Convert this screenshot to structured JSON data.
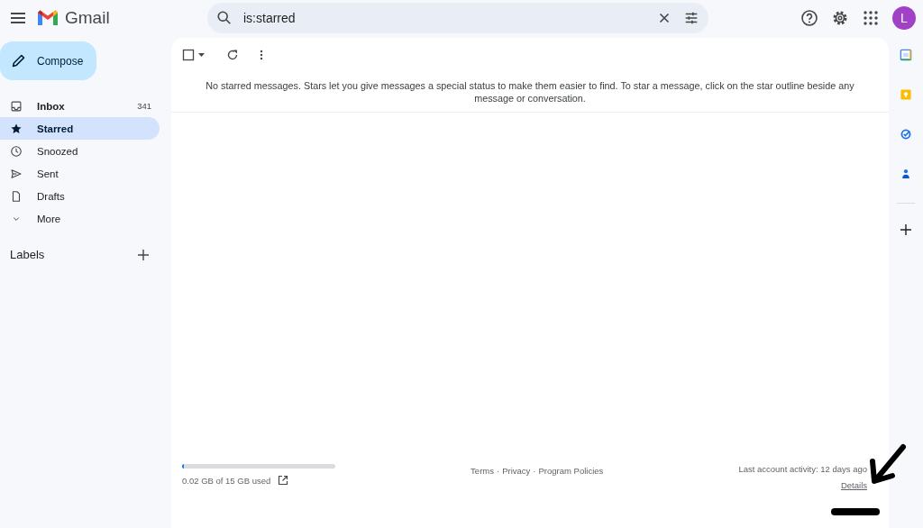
{
  "app": {
    "name": "Gmail"
  },
  "search": {
    "value": "is:starred"
  },
  "account": {
    "initial": "L",
    "color": "#a142c6"
  },
  "compose": {
    "label": "Compose"
  },
  "nav": [
    {
      "kind": "inbox",
      "label": "Inbox",
      "count": "341",
      "selected": false,
      "bold": true
    },
    {
      "kind": "star",
      "label": "Starred",
      "selected": true,
      "bold": true
    },
    {
      "kind": "clock",
      "label": "Snoozed",
      "selected": false,
      "bold": false
    },
    {
      "kind": "send",
      "label": "Sent",
      "selected": false,
      "bold": false
    },
    {
      "kind": "file",
      "label": "Drafts",
      "selected": false,
      "bold": false
    },
    {
      "kind": "more",
      "label": "More",
      "selected": false,
      "bold": false
    }
  ],
  "labels": {
    "title": "Labels"
  },
  "toolbar": {
    "select_all_checked": false
  },
  "empty_message": "No starred messages. Stars let you give messages a special status to make them easier to find. To star a message, click on the star outline beside any message or conversation.",
  "footer": {
    "storage": {
      "level": 0.01,
      "text": "0.02 GB of 15 GB used"
    },
    "links": [
      "Terms",
      "Privacy",
      "Program Policies"
    ],
    "separator": "·",
    "activity": "Last account activity: 12 days ago",
    "details": "Details"
  },
  "side_apps": [
    {
      "kind": "calendar"
    },
    {
      "kind": "keep"
    },
    {
      "kind": "tasks"
    },
    {
      "kind": "contacts"
    }
  ]
}
